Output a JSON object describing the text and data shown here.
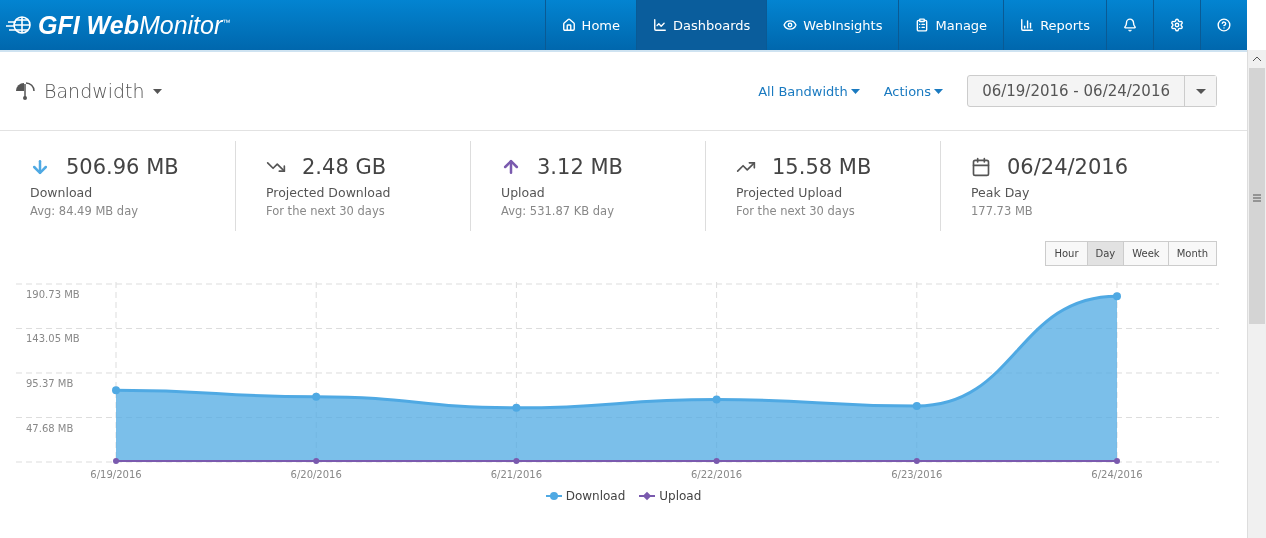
{
  "brand": {
    "bold": "GFI Web",
    "light": "Monitor",
    "mark": "™"
  },
  "nav": [
    {
      "kind": "home",
      "label": "Home",
      "selected": false
    },
    {
      "kind": "chart",
      "label": "Dashboards",
      "selected": true
    },
    {
      "kind": "eye",
      "label": "WebInsights",
      "selected": false
    },
    {
      "kind": "clipboard",
      "label": "Manage",
      "selected": false
    },
    {
      "kind": "bars",
      "label": "Reports",
      "selected": false
    },
    {
      "kind": "bell",
      "selected": false
    },
    {
      "kind": "gear",
      "selected": false
    },
    {
      "kind": "help",
      "selected": false
    }
  ],
  "page": {
    "title": "Bandwidth",
    "filters": [
      "All Bandwidth",
      "Actions"
    ],
    "date_range": "06/19/2016 - 06/24/2016"
  },
  "stats": [
    {
      "kind": "download",
      "value": "506.96 MB",
      "label": "Download",
      "sub": "Avg: 84.49 MB day"
    },
    {
      "kind": "projected-down",
      "value": "2.48 GB",
      "label": "Projected Download",
      "sub": "For the next 30 days"
    },
    {
      "kind": "upload",
      "value": "3.12 MB",
      "label": "Upload",
      "sub": "Avg: 531.87 KB day"
    },
    {
      "kind": "projected-up",
      "value": "15.58 MB",
      "label": "Projected Upload",
      "sub": "For the next 30 days"
    },
    {
      "kind": "calendar",
      "value": "06/24/2016",
      "label": "Peak Day",
      "sub": "177.73 MB"
    }
  ],
  "granularity": [
    {
      "label": "Hour",
      "selected": false
    },
    {
      "label": "Day",
      "selected": true
    },
    {
      "label": "Week",
      "selected": false
    },
    {
      "label": "Month",
      "selected": false
    }
  ],
  "chart_data": {
    "type": "area",
    "categories": [
      "6/19/2016",
      "6/20/2016",
      "6/21/2016",
      "6/22/2016",
      "6/23/2016",
      "6/24/2016"
    ],
    "series": [
      {
        "name": "Download",
        "color": "#4fa9e3",
        "values": [
          77,
          70,
          58,
          67,
          60,
          177.73
        ]
      },
      {
        "name": "Upload",
        "color": "#7a5aae",
        "values": [
          1,
          1,
          1,
          1,
          1,
          1
        ]
      }
    ],
    "grid": true,
    "ylim": [
      0,
      190.73
    ],
    "yticks": [
      {
        "value": 47.68,
        "label": "47.68 MB"
      },
      {
        "value": 95.37,
        "label": "95.37 MB"
      },
      {
        "value": 143.05,
        "label": "143.05 MB"
      },
      {
        "value": 190.73,
        "label": "190.73 MB"
      }
    ]
  }
}
